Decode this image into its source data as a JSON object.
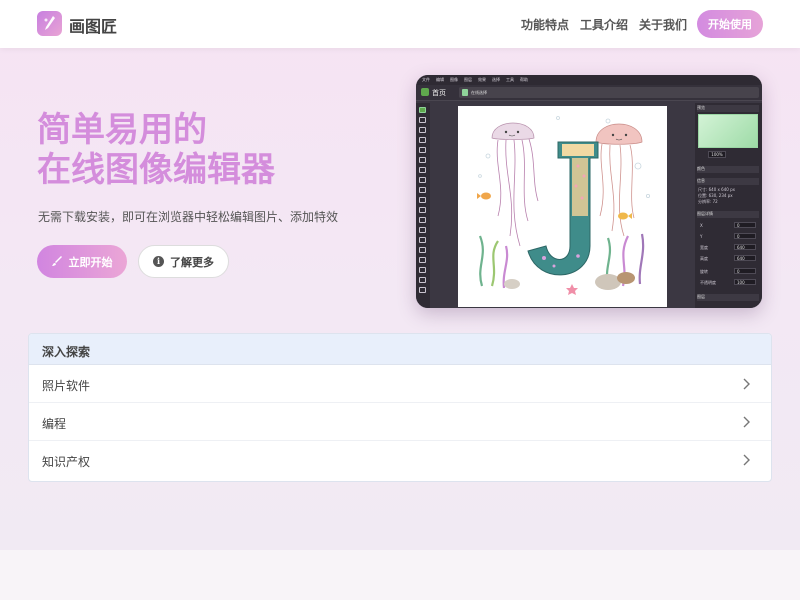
{
  "brand": {
    "name": "画图匠"
  },
  "nav": {
    "links": [
      "功能特点",
      "工具介绍",
      "关于我们"
    ],
    "cta": "开始使用"
  },
  "hero": {
    "title_line1": "简单易用的",
    "title_line2": "在线图像编辑器",
    "subtitle": "无需下载安装，即可在浏览器中轻松编辑图片、添加特效",
    "primary_button": "立即开始",
    "secondary_button": "了解更多"
  },
  "editor": {
    "menu": [
      "文件",
      "编辑",
      "图像",
      "图层",
      "效果",
      "选择",
      "工具",
      "帮助"
    ],
    "home_tab": "首页",
    "doc_tab": "在线选择",
    "panels": {
      "preview": "预览",
      "color": "颜色",
      "info": "信息",
      "layer_props": "图层详情",
      "layers": "图层"
    },
    "zoom": "100%",
    "info": [
      "尺寸: 640 x 640 px",
      "位置: 630, 234 px",
      "分辨率: 72"
    ],
    "props": [
      {
        "label": "X",
        "value": "0"
      },
      {
        "label": "Y",
        "value": "0"
      },
      {
        "label": "宽度",
        "value": "640"
      },
      {
        "label": "高度",
        "value": "640"
      },
      {
        "label": "旋转",
        "value": "0"
      },
      {
        "label": "不透明度",
        "value": "100"
      }
    ]
  },
  "explore": {
    "title": "深入探索",
    "items": [
      "照片软件",
      "编程",
      "知识产权"
    ]
  },
  "colors": {
    "accent": "#d48ddc",
    "button_gradient_start": "#d185e0",
    "button_gradient_end": "#eba6d6",
    "card_header": "#e8effb"
  }
}
